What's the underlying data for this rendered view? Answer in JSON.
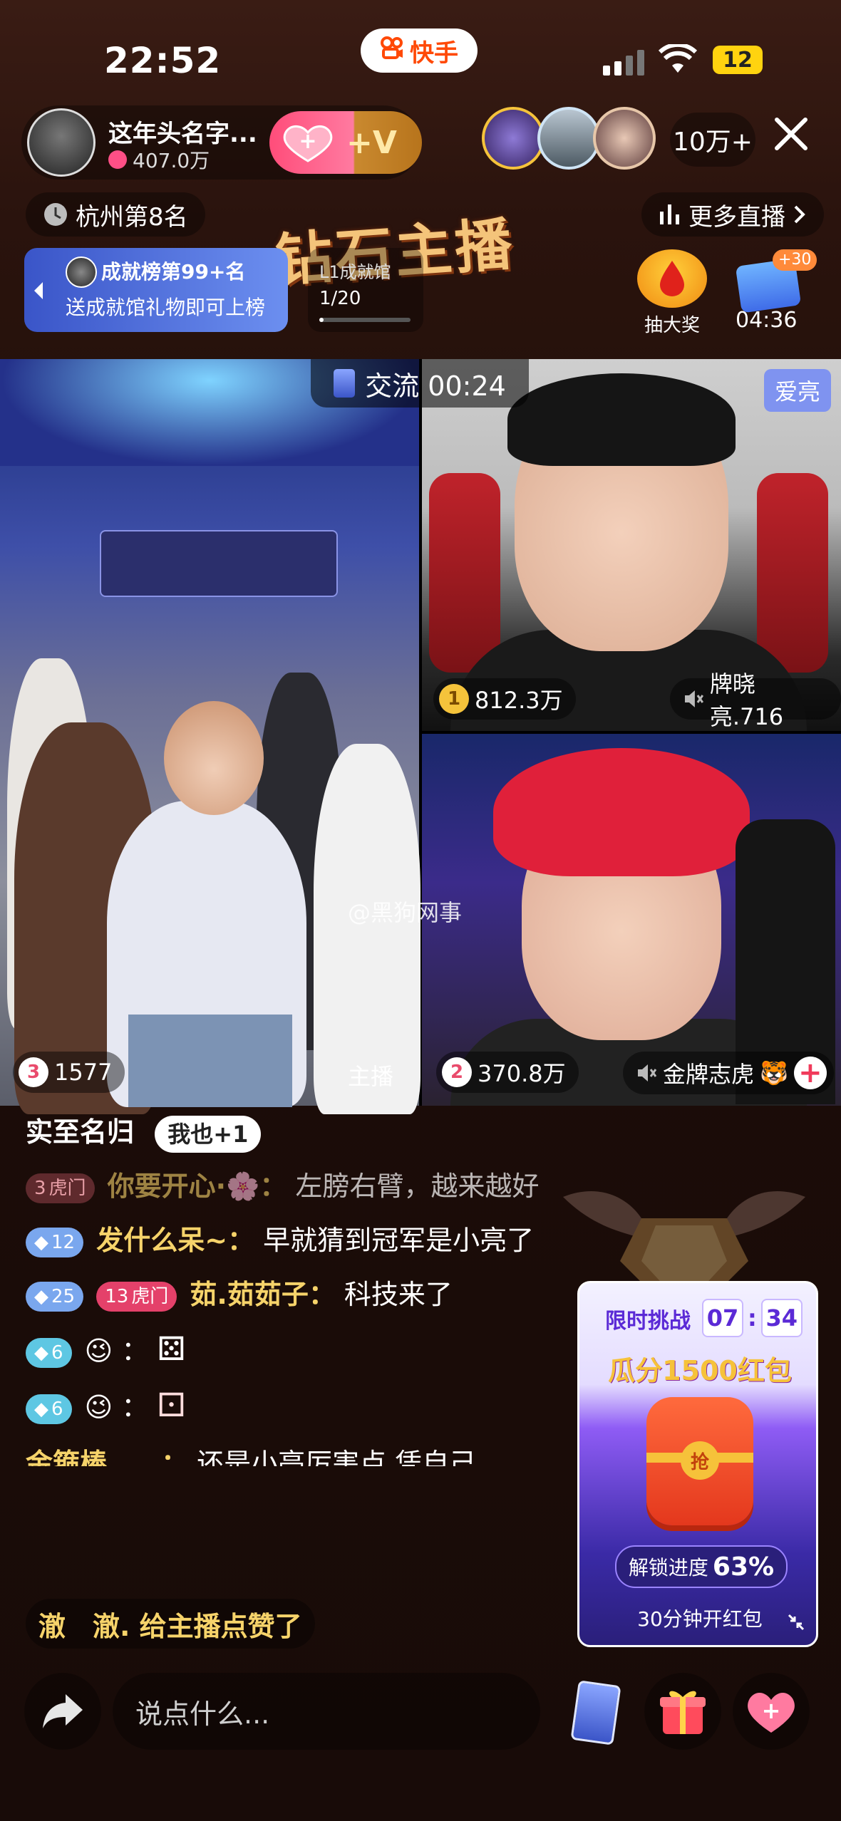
{
  "status_bar": {
    "time": "22:52",
    "app_name": "快手",
    "battery": "12"
  },
  "host": {
    "name": "这年头名字...",
    "likes": "407.0万",
    "follow_plus": "+V"
  },
  "viewers": {
    "count": "10万+"
  },
  "rank": {
    "label": "杭州第8名"
  },
  "more_live": {
    "label": "更多直播"
  },
  "banner_text": "钻石主播",
  "achievement": {
    "title": "成就榜第99+名",
    "subtitle": "送成就馆礼物即可上榜"
  },
  "hall": {
    "title": "L1成就馆",
    "progress": "1/20"
  },
  "lottery": {
    "label": "抽大奖"
  },
  "timer_box": {
    "badge": "+30",
    "time": "04:36"
  },
  "pk": {
    "exchange_label": "交流 00:24",
    "top_right": {
      "tag": "爱亮",
      "rank": "1",
      "score": "812.3万",
      "name": "牌晓亮.716"
    },
    "left": {
      "rank": "3",
      "score": "1577",
      "label": "主播"
    },
    "bottom_right": {
      "rank": "2",
      "score": "370.8万",
      "name": "金牌志虎"
    },
    "watermark": "@黑狗网事"
  },
  "chat": {
    "line1": {
      "text": "实至名归",
      "plus": "我也+1"
    },
    "line2": {
      "level": "3",
      "tag": "虎门",
      "user": "你要开心·🌸：",
      "msg": "左膀右臂，越来越好"
    },
    "line3": {
      "level": "12",
      "user": "发什么呆~：",
      "msg": "早就猜到冠军是小亮了"
    },
    "line4": {
      "level": "25",
      "tag_num": "13",
      "tag": "虎门",
      "user": "茹.茹茹子：",
      "msg": "科技来了"
    },
    "line5": {
      "level": "6",
      "emoji": "😉",
      "sep": "：",
      "dice": "⚄"
    },
    "line6": {
      "level": "6",
      "emoji": "😉",
      "sep": "：",
      "dice": "⚀"
    },
    "line7": {
      "user": "金箍棒……：",
      "msg": "还是小亮厉害点 凭自己"
    }
  },
  "like_banner": {
    "text": "澈　澈. 给主播点赞了"
  },
  "challenge": {
    "title": "限时挑战",
    "min": "07",
    "sec": "34",
    "main": "瓜分1500红包",
    "seal": "抢",
    "progress_label": "解锁进度",
    "progress_value": "63%",
    "footer": "30分钟开红包"
  },
  "comment": {
    "placeholder": "说点什么..."
  },
  "icons": [
    "clock-icon",
    "bars-icon",
    "chevron-right-icon",
    "close-icon",
    "mute-icon",
    "share-icon",
    "gift-icon",
    "heart-icon",
    "card-icon"
  ]
}
